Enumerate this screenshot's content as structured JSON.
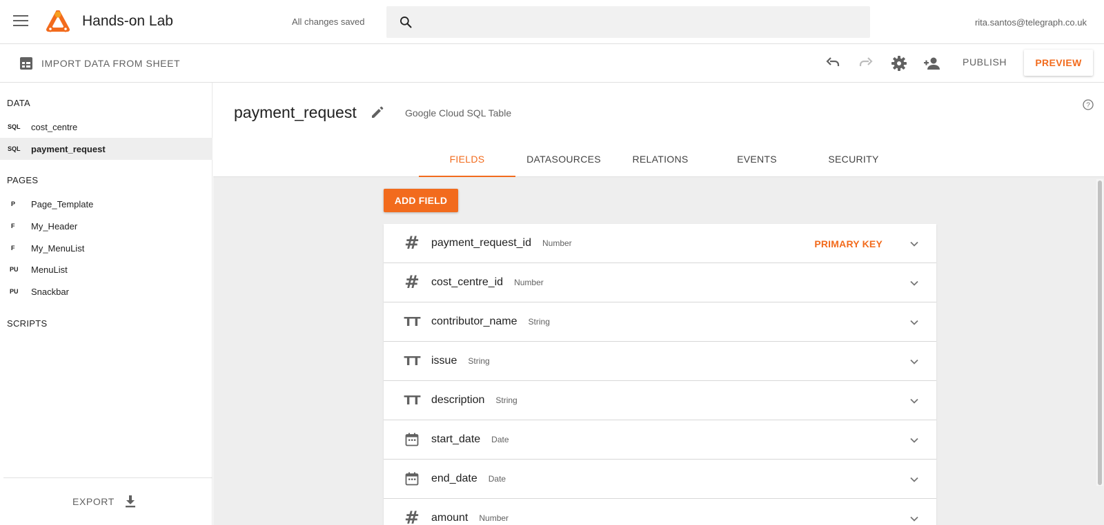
{
  "app": {
    "title": "Hands-on Lab",
    "save_status": "All changes saved",
    "user_email": "rita.santos@telegraph.co.uk",
    "accent_color": "#f26b1d"
  },
  "toolbar": {
    "import_label": "IMPORT DATA FROM SHEET",
    "publish_label": "PUBLISH",
    "preview_label": "PREVIEW"
  },
  "sidebar": {
    "data_title": "DATA",
    "data_items": [
      {
        "badge": "SQL",
        "name": "cost_centre"
      },
      {
        "badge": "SQL",
        "name": "payment_request"
      }
    ],
    "pages_title": "PAGES",
    "page_items": [
      {
        "badge": "P",
        "name": "Page_Template"
      },
      {
        "badge": "F",
        "name": "My_Header"
      },
      {
        "badge": "F",
        "name": "My_MenuList"
      },
      {
        "badge": "PU",
        "name": "MenuList"
      },
      {
        "badge": "PU",
        "name": "Snackbar"
      }
    ],
    "scripts_title": "SCRIPTS",
    "export_label": "EXPORT"
  },
  "model": {
    "name": "payment_request",
    "type": "Google Cloud SQL Table"
  },
  "tabs": [
    {
      "label": "FIELDS"
    },
    {
      "label": "DATASOURCES"
    },
    {
      "label": "RELATIONS"
    },
    {
      "label": "EVENTS"
    },
    {
      "label": "SECURITY"
    }
  ],
  "add_field_label": "ADD FIELD",
  "fields": [
    {
      "name": "payment_request_id",
      "type": "Number",
      "icon": "hash-icon",
      "tag": "PRIMARY KEY"
    },
    {
      "name": "cost_centre_id",
      "type": "Number",
      "icon": "hash-icon",
      "tag": ""
    },
    {
      "name": "contributor_name",
      "type": "String",
      "icon": "text-type-icon",
      "tag": ""
    },
    {
      "name": "issue",
      "type": "String",
      "icon": "text-type-icon",
      "tag": ""
    },
    {
      "name": "description",
      "type": "String",
      "icon": "text-type-icon",
      "tag": ""
    },
    {
      "name": "start_date",
      "type": "Date",
      "icon": "calendar-icon",
      "tag": ""
    },
    {
      "name": "end_date",
      "type": "Date",
      "icon": "calendar-icon",
      "tag": ""
    },
    {
      "name": "amount",
      "type": "Number",
      "icon": "hash-icon",
      "tag": ""
    }
  ]
}
